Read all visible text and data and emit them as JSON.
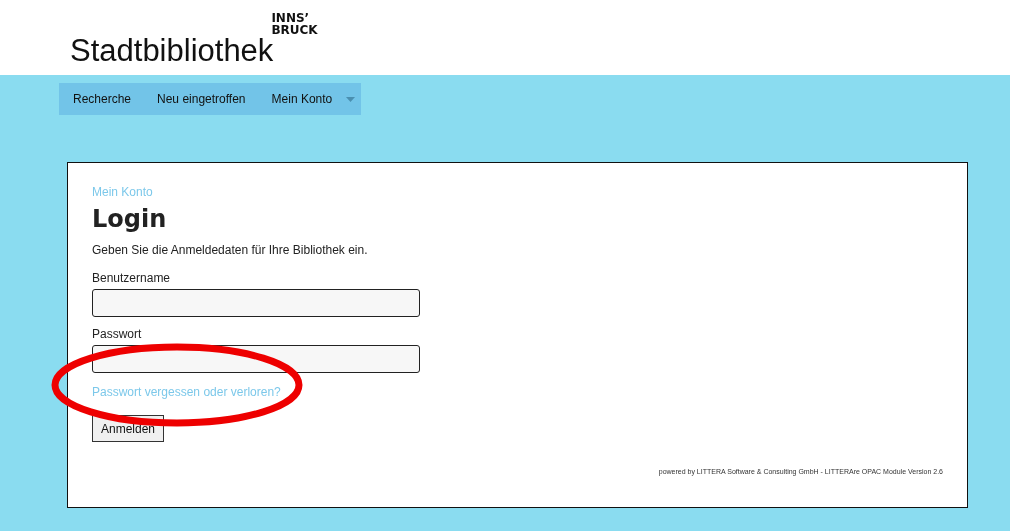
{
  "header": {
    "logo_text": "Stadtbibliothek",
    "logo_mark_line_1": "INNS’",
    "logo_mark_line_2": "BRUCK"
  },
  "nav": {
    "items": [
      {
        "label": "Recherche",
        "kind": "link"
      },
      {
        "label": "Neu eingetroffen",
        "kind": "link"
      },
      {
        "label": "Mein Konto",
        "kind": "dropdown"
      }
    ]
  },
  "card": {
    "breadcrumb": "Mein Konto",
    "title": "Login",
    "intro": "Geben Sie die Anmeldedaten für Ihre Bibliothek ein.",
    "fields": [
      {
        "label": "Benutzername"
      },
      {
        "label": "Passwort"
      }
    ],
    "forgot_link": "Passwort vergessen oder verloren?",
    "submit": "Anmelden",
    "footer": "powered by LITTERA Software & Consulting GmbH - LITTERAre OPAC Module Version 2.6"
  },
  "annotation": {
    "kind": "ellipse",
    "color": "#ee0000"
  }
}
